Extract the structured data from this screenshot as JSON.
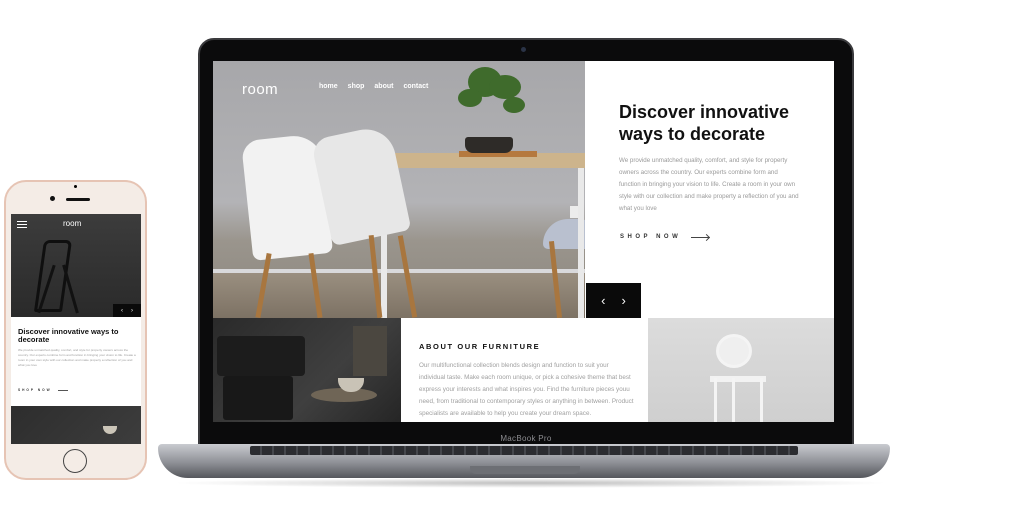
{
  "laptop": {
    "brand": "MacBook Pro",
    "site": {
      "logo": "room",
      "nav": [
        "home",
        "shop",
        "about",
        "contact"
      ],
      "hero": {
        "title": "Discover innovative ways to decorate",
        "description": "We provide unmatched quality, comfort, and style for property owners across the country. Our experts combine form and function in bringing your vision to life. Create a room in your own style with our collection and make property a reflection of you and what you love",
        "cta": "SHOP NOW",
        "prev": "‹",
        "next": "›"
      },
      "about": {
        "title": "ABOUT OUR FURNITURE",
        "description": "Our multifunctional collection blends design and function to suit your individual taste. Make each room unique, or pick a cohesive theme that best express your interests and what inspires you. Find the furniture pieces youu need, from traditional to contemporary styles or anything in between. Product specialists are available to help you create your dream space."
      }
    }
  },
  "phone": {
    "site": {
      "logo": "room",
      "hero": {
        "title": "Discover innovative ways to decorate",
        "description": "We provide unmatched quality, comfort, and style for property owners across the country. Our experts combine form and function in bringing your vision to life. Create a room in your own style with our collection and make property a reflection of you and what you love",
        "cta": "SHOP NOW",
        "prev": "‹",
        "next": "›"
      }
    }
  },
  "colors": {
    "accent": "#0a0a0a",
    "body_text": "#9a9a9a",
    "heading": "#111111",
    "phone_frame": "#e6c4b4"
  }
}
